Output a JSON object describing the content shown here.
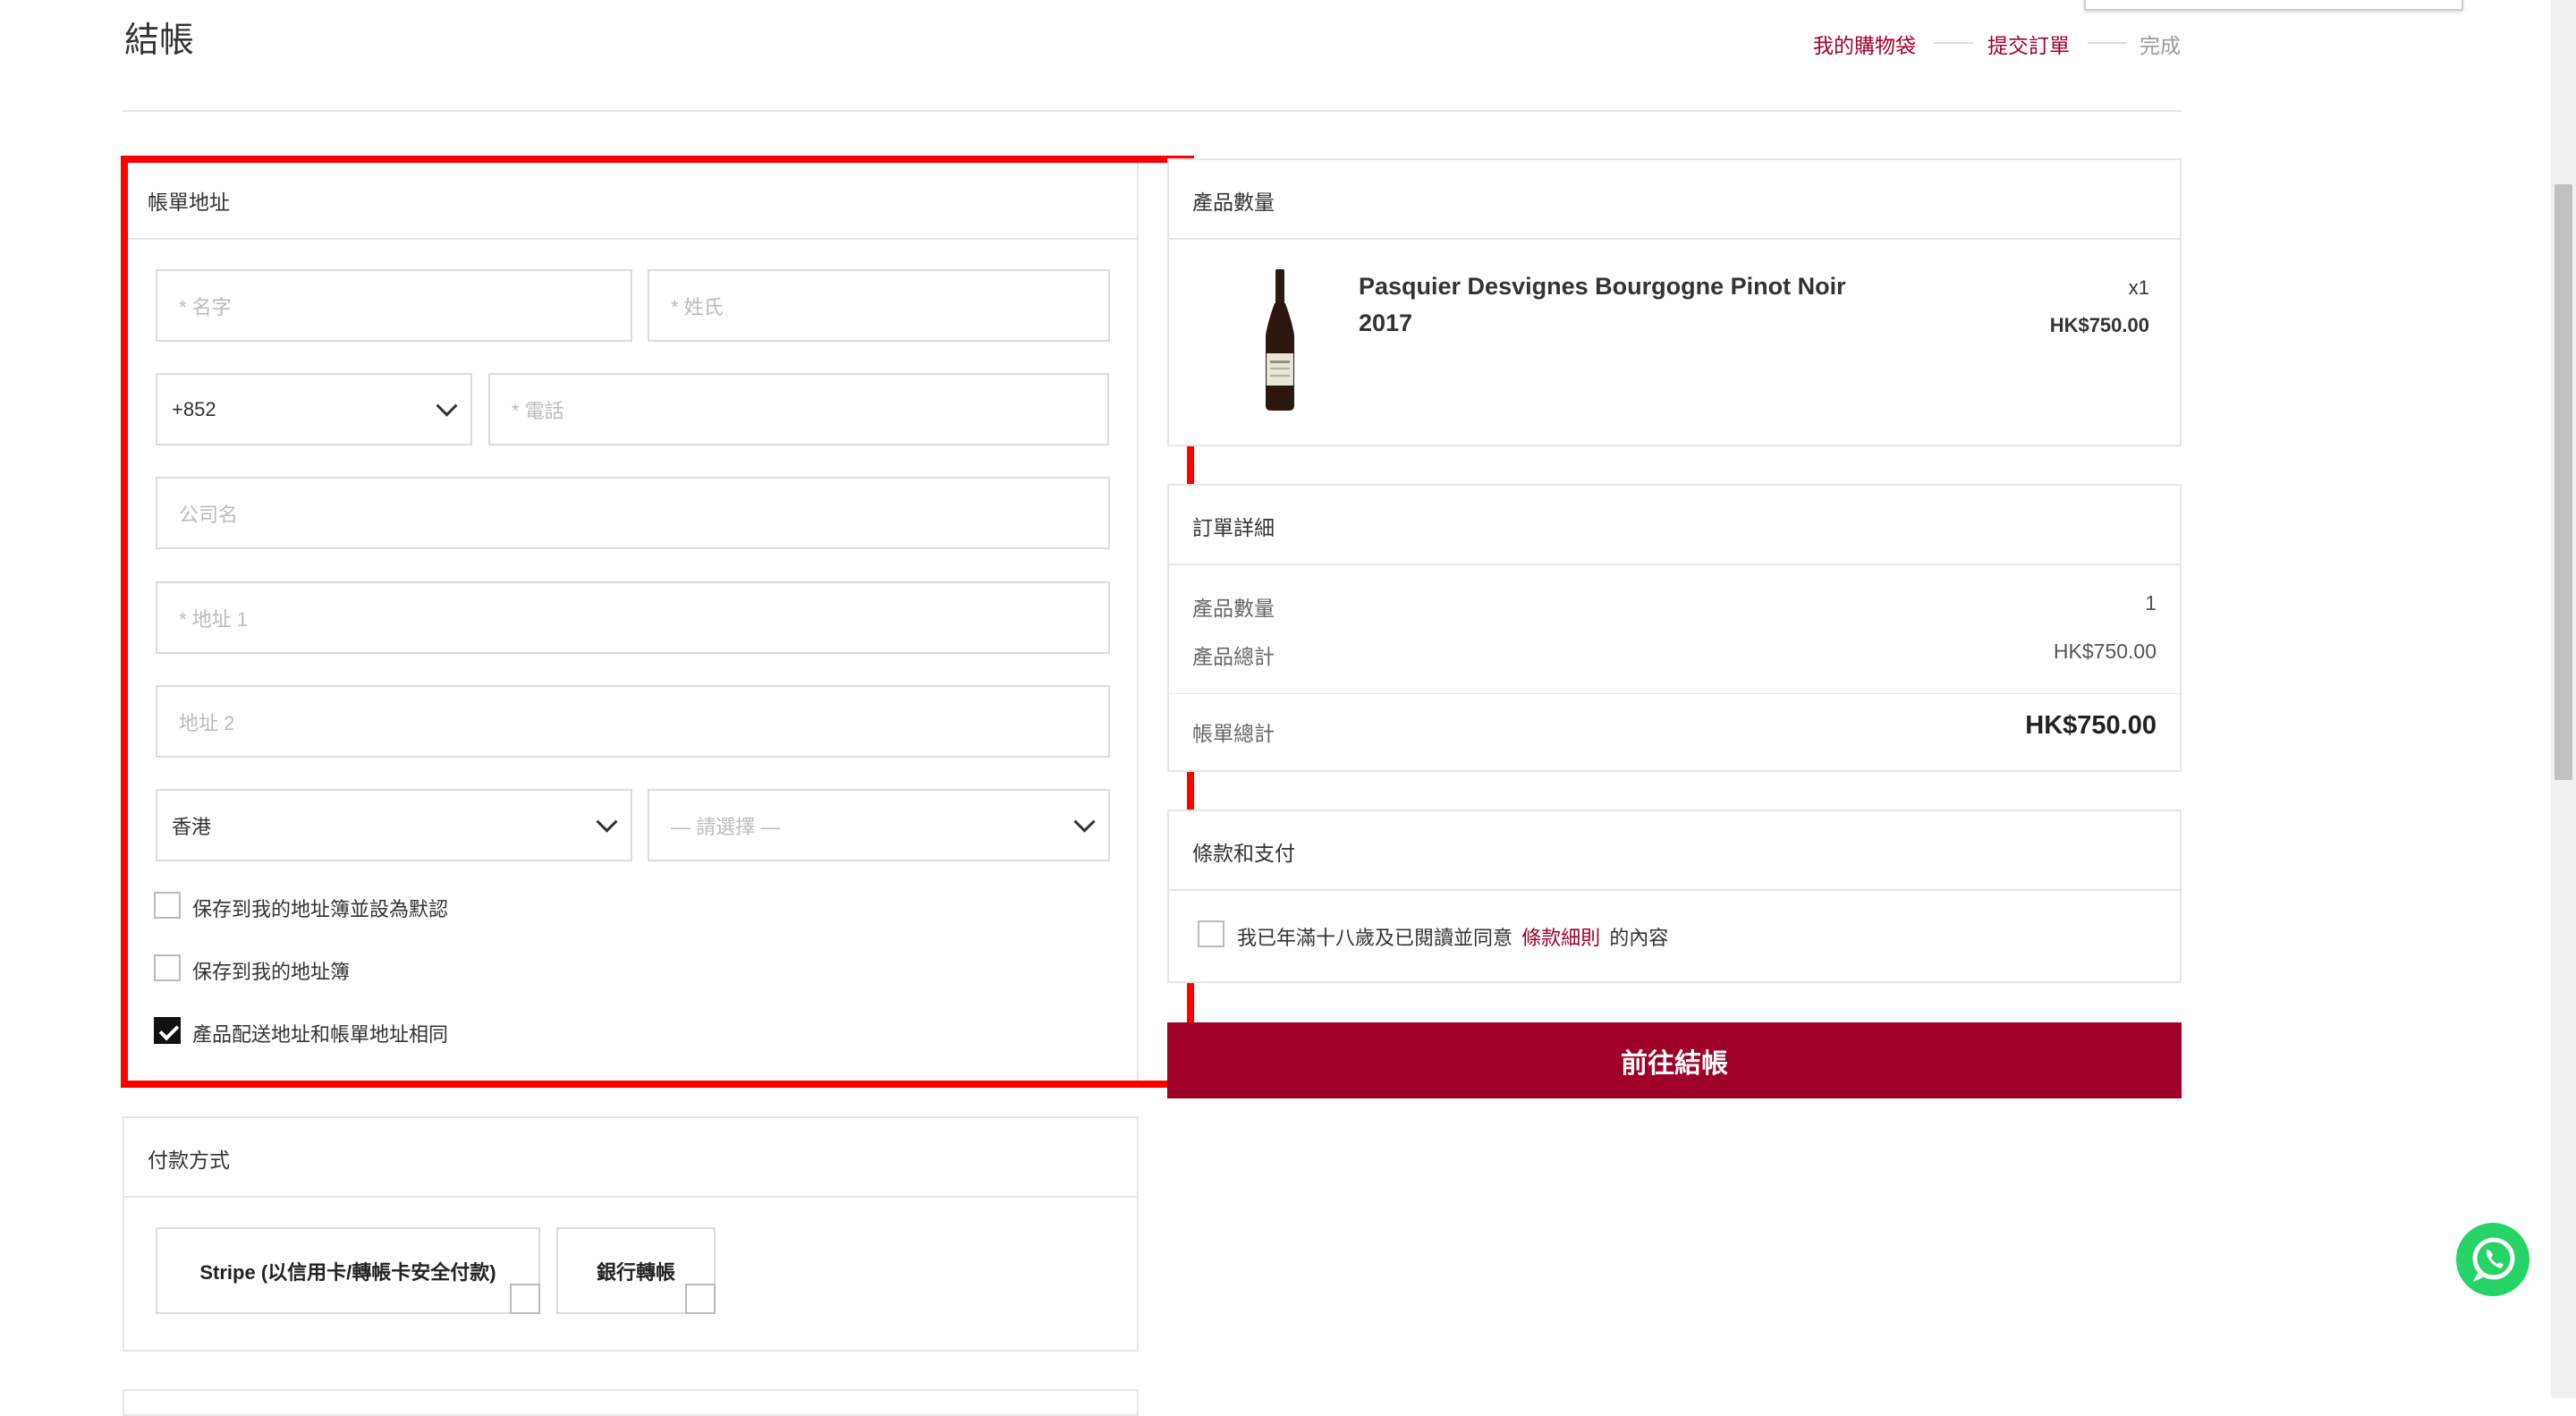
{
  "page": {
    "title": "結帳"
  },
  "steps": [
    "我的購物袋",
    "提交訂單",
    "完成"
  ],
  "billing": {
    "title": "帳單地址",
    "first_name_placeholder": "* 名字",
    "last_name_placeholder": "* 姓氏",
    "country_code": "+852",
    "phone_placeholder": "* 電話",
    "company_placeholder": "公司名",
    "address1_placeholder": "* 地址 1",
    "address2_placeholder": "地址 2",
    "region": "香港",
    "district_placeholder": "— 請選擇 —",
    "checkboxes": [
      {
        "label": "保存到我的地址簿並設為默認",
        "checked": false
      },
      {
        "label": "保存到我的地址簿",
        "checked": false
      },
      {
        "label": "產品配送地址和帳單地址相同",
        "checked": true
      }
    ]
  },
  "payment": {
    "title": "付款方式",
    "options": [
      "Stripe (以信用卡/轉帳卡安全付款)",
      "銀行轉帳"
    ]
  },
  "products": {
    "title": "產品數量",
    "items": [
      {
        "name": "Pasquier Desvignes Bourgogne Pinot Noir 2017",
        "qty": "x1",
        "price": "HK$750.00"
      }
    ]
  },
  "order": {
    "title": "訂單詳細",
    "rows": [
      {
        "label": "產品數量",
        "value": "1"
      },
      {
        "label": "產品總計",
        "value": "HK$750.00"
      }
    ],
    "total_label": "帳單總計",
    "total_value": "HK$750.00"
  },
  "terms": {
    "title": "條款和支付",
    "prefix": "我已年滿十八歲及已閱讀並同意",
    "link": "條款細則",
    "suffix": "的內容"
  },
  "checkout_button": "前往結帳",
  "colors": {
    "accent": "#9e0029",
    "highlight": "#ff0000",
    "whatsapp": "#25d366"
  },
  "icons": [
    "chevron-down-icon",
    "wine-bottle-icon",
    "whatsapp-icon",
    "checkmark-icon"
  ]
}
